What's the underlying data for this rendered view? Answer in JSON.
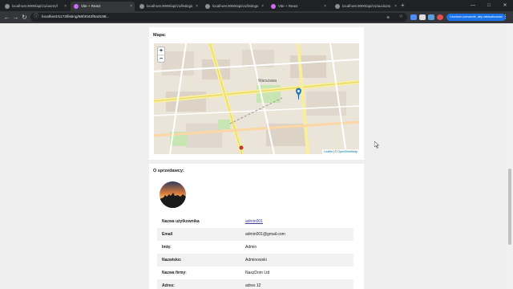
{
  "browser": {
    "tabs": [
      {
        "title": "localhost:3000/api/v1/users/l",
        "icon": "globe-icon",
        "active": false
      },
      {
        "title": "Vite + React",
        "icon": "vite-icon",
        "active": true
      },
      {
        "title": "localhost:3000/api/v1/listings",
        "icon": "globe-icon",
        "active": false
      },
      {
        "title": "localhost:3000/api/v1/listings",
        "icon": "globe-icon",
        "active": false
      },
      {
        "title": "Vite + React",
        "icon": "vite-icon",
        "active": false
      },
      {
        "title": "localhost:3000/api/v1/auctions",
        "icon": "globe-icon",
        "active": false
      }
    ],
    "url": "localhost:5173/listing/66f4042f6a3188...",
    "assistant_label": "Uruchom ponownie, aby zaktualizować"
  },
  "map_section": {
    "title": "Mapa:",
    "zoom_in": "+",
    "zoom_out": "−",
    "city_label": "Warszawa",
    "attribution_leaflet": "Leaflet",
    "attribution_sep": " | © ",
    "attribution_osm": "OpenStreetMap"
  },
  "seller_section": {
    "title": "O sprzedawcy:",
    "rows": [
      {
        "label": "Nazwa użytkownika",
        "value": "admin001",
        "is_link": true
      },
      {
        "label": "Email",
        "value": "admin001@gmail.com",
        "is_link": false
      },
      {
        "label": "Imię:",
        "value": "Admin",
        "is_link": false
      },
      {
        "label": "Nazwisko:",
        "value": "Adminowski",
        "is_link": false
      },
      {
        "label": "Nazwa firmy:",
        "value": "NaszDom Ltd",
        "is_link": false
      },
      {
        "label": "Adres:",
        "value": "adres 12",
        "is_link": false
      }
    ]
  },
  "colors": {
    "accent": "#1a73e8",
    "marker": "#2a81cb",
    "link": "#3b3b9a"
  }
}
